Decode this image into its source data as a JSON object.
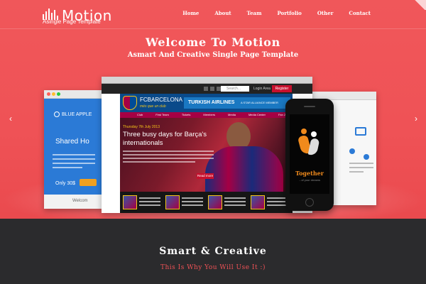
{
  "header": {
    "logo_text": "Motion",
    "logo_subtitle": "Asingle Page Template",
    "nav": [
      "Home",
      "About",
      "Team",
      "Portfolio",
      "Other",
      "Contact"
    ]
  },
  "hero": {
    "title": "Welcome To Motion",
    "subtitle": "Asmart And Creative Single Page Template",
    "prev_arrow": "‹",
    "next_arrow": "›",
    "left_window": {
      "brand": "BLUE APPLE",
      "heading": "Shared Ho",
      "price": "Only 30$",
      "footer": "Welcom"
    },
    "main_window": {
      "search_placeholder": "Search...",
      "login": "Login Area",
      "register": "Register",
      "club_name": "FCBARCELONA",
      "club_tagline": "més que un club",
      "sponsor": "TURKISH AIRLINES",
      "alliance": "A STAR ALLIANCE MEMBER",
      "nav": [
        "Club",
        "First Team",
        "Tickets",
        "Members",
        "Media",
        "Media Center",
        "Fan Zone"
      ],
      "article_date": "Thursday 7th July 2013",
      "article_title": "Three busy days for Barça's internationals",
      "read_more": "Read more"
    },
    "phone": {
      "app_name": "Together",
      "app_tagline": "...of your dreams"
    }
  },
  "section": {
    "title": "Smart & Creative",
    "subtitle": "This Is Why You Will Use It :)"
  },
  "colors": {
    "hero_bg": "#ef5256",
    "dark_bg": "#2b2b2d",
    "accent": "#ef5256"
  }
}
